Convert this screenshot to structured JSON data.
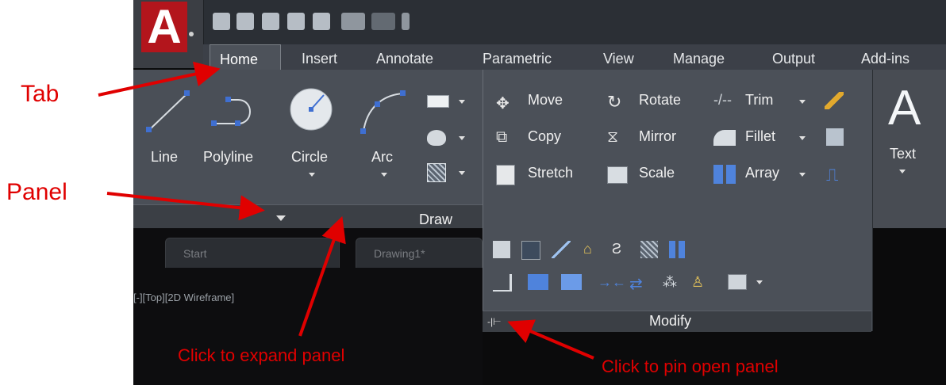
{
  "logo": {
    "letter": "A"
  },
  "tabs": [
    {
      "label": "Home"
    },
    {
      "label": "Insert"
    },
    {
      "label": "Annotate"
    },
    {
      "label": "Parametric"
    },
    {
      "label": "View"
    },
    {
      "label": "Manage"
    },
    {
      "label": "Output"
    },
    {
      "label": "Add-ins"
    }
  ],
  "draw_panel": {
    "tools": [
      {
        "label": "Line",
        "icon": "line-icon"
      },
      {
        "label": "Polyline",
        "icon": "polyline-icon"
      },
      {
        "label": "Circle",
        "icon": "circle-icon"
      },
      {
        "label": "Arc",
        "icon": "arc-icon"
      }
    ],
    "title": "Draw"
  },
  "modify_panel": {
    "rows": [
      [
        {
          "label": "Move",
          "icon": "move-icon"
        },
        {
          "label": "Rotate",
          "icon": "rotate-icon"
        },
        {
          "label": "Trim",
          "icon": "trim-icon"
        }
      ],
      [
        {
          "label": "Copy",
          "icon": "copy-icon"
        },
        {
          "label": "Mirror",
          "icon": "mirror-icon"
        },
        {
          "label": "Fillet",
          "icon": "fillet-icon"
        }
      ],
      [
        {
          "label": "Stretch",
          "icon": "stretch-icon"
        },
        {
          "label": "Scale",
          "icon": "scale-icon"
        },
        {
          "label": "Array",
          "icon": "array-icon"
        }
      ]
    ],
    "title": "Modify"
  },
  "text_panel": {
    "letter": "A",
    "label": "Text"
  },
  "file_tabs": [
    {
      "label": "Start"
    },
    {
      "label": "Drawing1*"
    }
  ],
  "viewport": {
    "label": "[-][Top][2D Wireframe]"
  },
  "annotations": {
    "tab": "Tab",
    "panel": "Panel",
    "expand": "Click to expand panel",
    "pin": "Click to pin open panel"
  },
  "colors": {
    "annotation": "#e00000",
    "logo": "#b3151c",
    "ribbon": "#484c53"
  }
}
